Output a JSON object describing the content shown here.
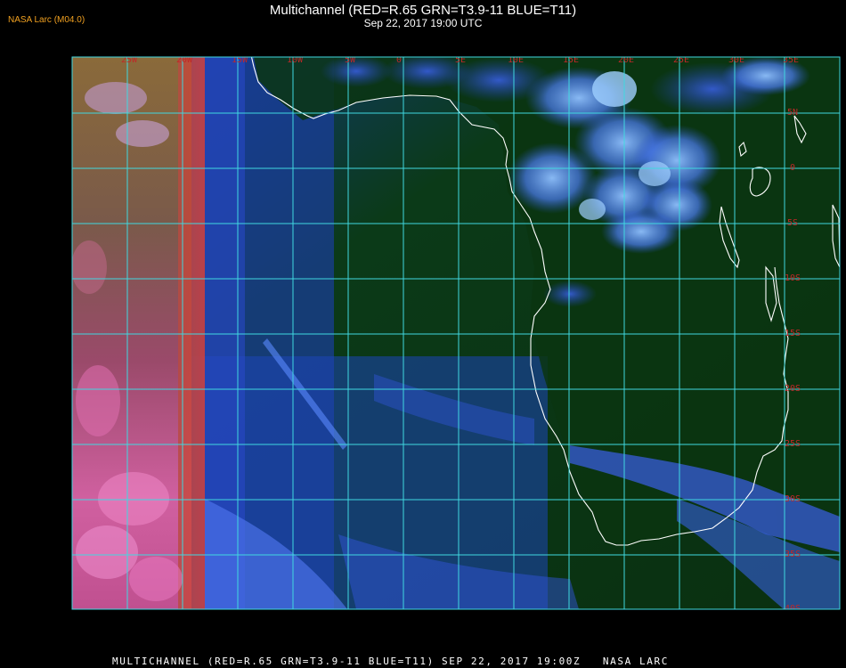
{
  "header": {
    "title": "Multichannel (RED=R.65 GRN=T3.9-11 BLUE=T11)",
    "subtitle": "Sep 22, 2017 19:00 UTC",
    "credit": "NASA Larc (M04.0)"
  },
  "footer": {
    "caption": "MULTICHANNEL (RED=R.65 GRN=T3.9-11 BLUE=T11) SEP 22, 2017 19:00Z   NASA LARC"
  },
  "map": {
    "longitude_labels": [
      "25W",
      "20W",
      "15W",
      "10W",
      "5W",
      "0",
      "5E",
      "10E",
      "15E",
      "20E",
      "25E",
      "30E",
      "35E"
    ],
    "latitude_labels": [
      "5N",
      "0",
      "5S",
      "10S",
      "15S",
      "20S",
      "25S",
      "30S",
      "35S",
      "40S"
    ],
    "colors": {
      "grid": "#40d8e0",
      "label": "#c02828",
      "coastline": "#ffffff",
      "ocean": "#0a3a10",
      "cloud": "#4a70f0",
      "sun_glint": "#d06080"
    }
  }
}
